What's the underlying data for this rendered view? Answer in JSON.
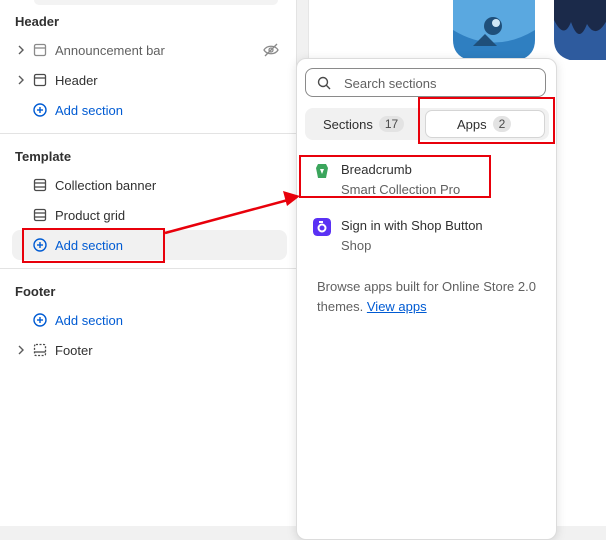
{
  "sidebar": {
    "groups": {
      "header": {
        "title": "Header",
        "items": [
          {
            "label": "Announcement bar"
          },
          {
            "label": "Header"
          }
        ],
        "add_label": "Add section"
      },
      "template": {
        "title": "Template",
        "items": [
          {
            "label": "Collection banner"
          },
          {
            "label": "Product grid"
          }
        ],
        "add_label": "Add section"
      },
      "footer": {
        "title": "Footer",
        "add_label": "Add section",
        "items": [
          {
            "label": "Footer"
          }
        ]
      }
    }
  },
  "popover": {
    "search_placeholder": "Search sections",
    "tabs": [
      {
        "label": "Sections",
        "count": "17"
      },
      {
        "label": "Apps",
        "count": "2",
        "selected": true
      }
    ],
    "apps": [
      {
        "name": "Breadcrumb",
        "vendor": "Smart Collection Pro",
        "icon": "breadcrumb-app-icon"
      },
      {
        "name": "Sign in with Shop Button",
        "vendor": "Shop",
        "icon": "shop-app-icon"
      }
    ],
    "browse_text": "Browse apps built for Online Store 2.0 themes.",
    "browse_link": "View apps"
  },
  "colors": {
    "accent_blue": "#005bd3",
    "annotation_red": "#e8000b",
    "shop_purple": "#5a31f4",
    "breadcrumb_green": "#3ba55c"
  }
}
